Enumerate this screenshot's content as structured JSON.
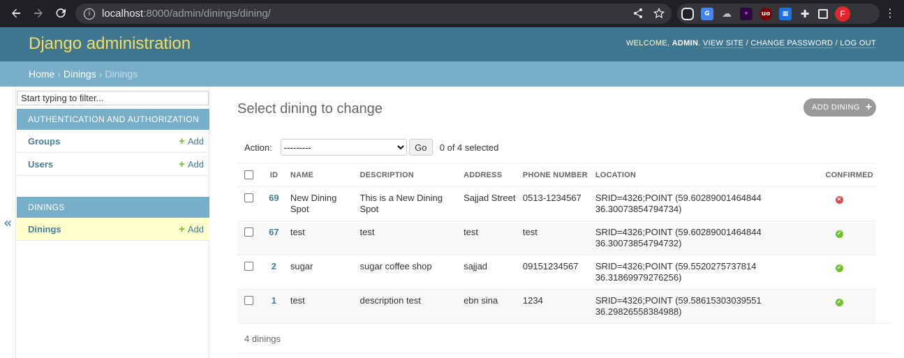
{
  "browser": {
    "url_host": "localhost",
    "url_path": ":8000/admin/dinings/dining/",
    "avatar_letter": "F",
    "extensions": [
      "ext-1",
      "translate-icon",
      "cloud-icon",
      "ext-dark",
      "ublock-icon",
      "ext-grid",
      "puzzle-icon"
    ]
  },
  "header": {
    "branding": "Django administration",
    "welcome": "WELCOME,",
    "username": "ADMIN",
    "view_site": "VIEW SITE",
    "change_password": "CHANGE PASSWORD",
    "log_out": "LOG OUT"
  },
  "breadcrumbs": {
    "home": "Home",
    "app": "Dinings",
    "current": "Dinings"
  },
  "sidebar": {
    "filter_placeholder": "Start typing to filter...",
    "modules": [
      {
        "caption": "AUTHENTICATION AND AUTHORIZATION",
        "models": [
          {
            "name": "Groups",
            "add": "Add"
          },
          {
            "name": "Users",
            "add": "Add"
          }
        ]
      },
      {
        "caption": "DININGS",
        "models": [
          {
            "name": "Dinings",
            "add": "Add"
          }
        ]
      }
    ],
    "collapse_icon": "«"
  },
  "main": {
    "title": "Select dining to change",
    "add_button": "ADD DINING",
    "action_label": "Action:",
    "action_selected": "---------",
    "go_label": "Go",
    "counter": "0 of 4 selected",
    "columns": [
      "ID",
      "NAME",
      "DESCRIPTION",
      "ADDRESS",
      "PHONE NUMBER",
      "LOCATION",
      "CONFIRMED"
    ],
    "rows": [
      {
        "id": "69",
        "name": "New Dining Spot",
        "description": "This is a New Dining Spot",
        "address": "Sajjad Street",
        "phone": "0513-1234567",
        "location": "SRID=4326;POINT (59.60289001464844 36.30073854794734)",
        "confirmed": false
      },
      {
        "id": "67",
        "name": "test",
        "description": "test",
        "address": "test",
        "phone": "test",
        "location": "SRID=4326;POINT (59.60289001464844 36.30073854794732)",
        "confirmed": true
      },
      {
        "id": "2",
        "name": "sugar",
        "description": "sugar coffee shop",
        "address": "sajjad",
        "phone": "09151234567",
        "location": "SRID=4326;POINT (59.5520275737814 36.31869979276256)",
        "confirmed": true
      },
      {
        "id": "1",
        "name": "test",
        "description": "description test",
        "address": "ebn sina",
        "phone": "1234",
        "location": "SRID=4326;POINT (59.58615303039551 36.29826558384988)",
        "confirmed": true
      }
    ],
    "paginator": "4 dinings"
  },
  "colors": {
    "header_bg": "#417690",
    "branding": "#f5dd5d",
    "breadcrumbs_bg": "#79aec8",
    "link": "#447e9b",
    "add_green": "#70bf2b",
    "status_yes": "#70bf2b",
    "status_no": "#dd4646"
  }
}
